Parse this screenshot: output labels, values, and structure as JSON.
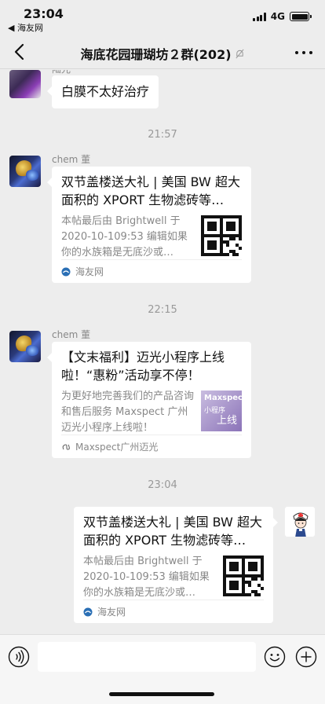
{
  "status_bar": {
    "time": "23:04",
    "back_app": "◀ 海友网",
    "network": "4G",
    "battery_level": 1.0
  },
  "nav": {
    "title": "海底花园珊瑚坊２群(202)"
  },
  "messages": [
    {
      "sender": "陆光",
      "text": "白膜不太好治疗"
    },
    {
      "timestamp": "21:57"
    },
    {
      "sender": "chem 董",
      "card": {
        "title": "双节盖楼送大礼 | 美国 BW 超大面积的 XPORT 生物滤砖等…",
        "desc": "本帖最后由 Brightwell 于 2020-10-109:53 编辑如果你的水族箱是无底沙或…",
        "source": "海友网"
      }
    },
    {
      "timestamp": "22:15"
    },
    {
      "sender": "chem 董",
      "card": {
        "title": "【文末福利】迈光小程序上线啦！“惠粉”活动享不停！",
        "desc": "为更好地完善我们的产品咨询和售后服务 Maxspect 广州迈光小程序上线啦！",
        "source": "Maxspect广州迈光",
        "thumb_text": [
          "Maxspect",
          "小程序",
          "上线"
        ]
      }
    },
    {
      "timestamp": "23:04"
    },
    {
      "self": true,
      "card": {
        "title": "双节盖楼送大礼 | 美国 BW 超大面积的 XPORT 生物滤砖等…",
        "desc": "本帖最后由 Brightwell 于 2020-10-109:53 编辑如果你的水族箱是无底沙或…",
        "source": "海友网"
      }
    }
  ],
  "input_bar": {
    "icons": [
      "voice-icon",
      "emoji-icon",
      "plus-icon"
    ]
  }
}
